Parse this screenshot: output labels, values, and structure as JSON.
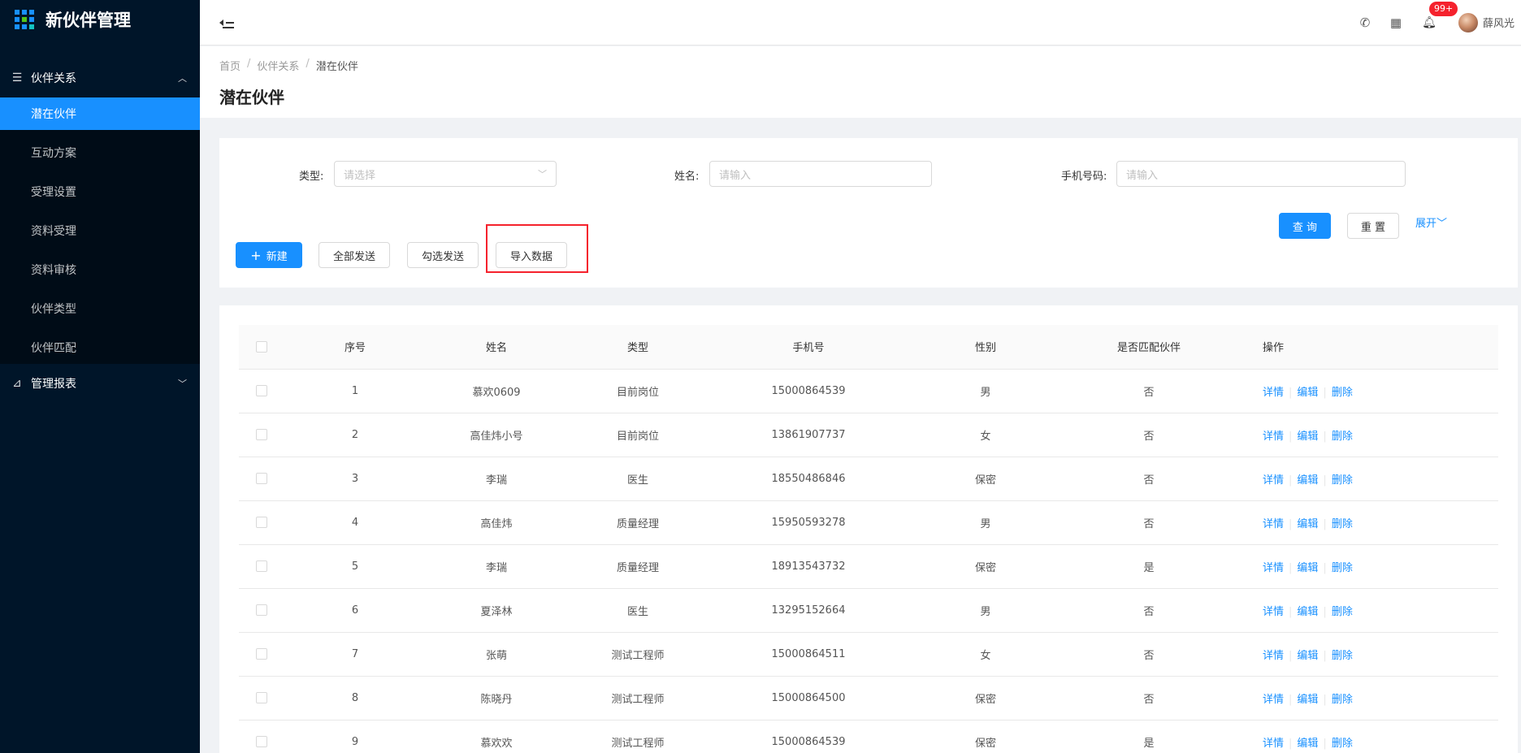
{
  "app": {
    "title": "新伙伴管理"
  },
  "sidebar": {
    "group1": {
      "label": "伙伴关系",
      "icon": "menu-list-icon"
    },
    "items": [
      {
        "label": "潜在伙伴",
        "active": true
      },
      {
        "label": "互动方案"
      },
      {
        "label": "受理设置"
      },
      {
        "label": "资料受理"
      },
      {
        "label": "资料审核"
      },
      {
        "label": "伙伴类型"
      },
      {
        "label": "伙伴匹配"
      }
    ],
    "group2": {
      "label": "管理报表",
      "icon": "chart-icon"
    }
  },
  "header": {
    "badge": "99+",
    "username": "薛风光"
  },
  "breadcrumb": [
    "首页",
    "伙伴关系",
    "潜在伙伴"
  ],
  "page_title": "潜在伙伴",
  "filters": {
    "type": {
      "label": "类型:",
      "placeholder": "请选择"
    },
    "name": {
      "label": "姓名:",
      "placeholder": "请输入"
    },
    "phone": {
      "label": "手机号码:",
      "placeholder": "请输入"
    }
  },
  "buttons": {
    "query": "查 询",
    "reset": "重 置",
    "expand": "展开",
    "create": "新建",
    "send_all": "全部发送",
    "send_selected": "勾选发送",
    "import": "导入数据"
  },
  "table": {
    "columns": [
      "序号",
      "姓名",
      "类型",
      "手机号",
      "性别",
      "是否匹配伙伴",
      "操作"
    ],
    "actions": [
      "详情",
      "编辑",
      "删除"
    ],
    "rows": [
      [
        "1",
        "慕欢0609",
        "目前岗位",
        "15000864539",
        "男",
        "否"
      ],
      [
        "2",
        "高佳炜小号",
        "目前岗位",
        "13861907737",
        "女",
        "否"
      ],
      [
        "3",
        "李瑞",
        "医生",
        "18550486846",
        "保密",
        "否"
      ],
      [
        "4",
        "高佳炜",
        "质量经理",
        "15950593278",
        "男",
        "否"
      ],
      [
        "5",
        "李瑞",
        "质量经理",
        "18913543732",
        "保密",
        "是"
      ],
      [
        "6",
        "夏泽林",
        "医生",
        "13295152664",
        "男",
        "否"
      ],
      [
        "7",
        "张萌",
        "测试工程师",
        "15000864511",
        "女",
        "否"
      ],
      [
        "8",
        "陈晓丹",
        "测试工程师",
        "15000864500",
        "保密",
        "否"
      ],
      [
        "9",
        "慕欢欢",
        "测试工程师",
        "15000864539",
        "保密",
        "是"
      ]
    ]
  },
  "colors": {
    "sidebar_bg": "#001529",
    "primary": "#1890ff",
    "highlight": "#f5222d"
  }
}
